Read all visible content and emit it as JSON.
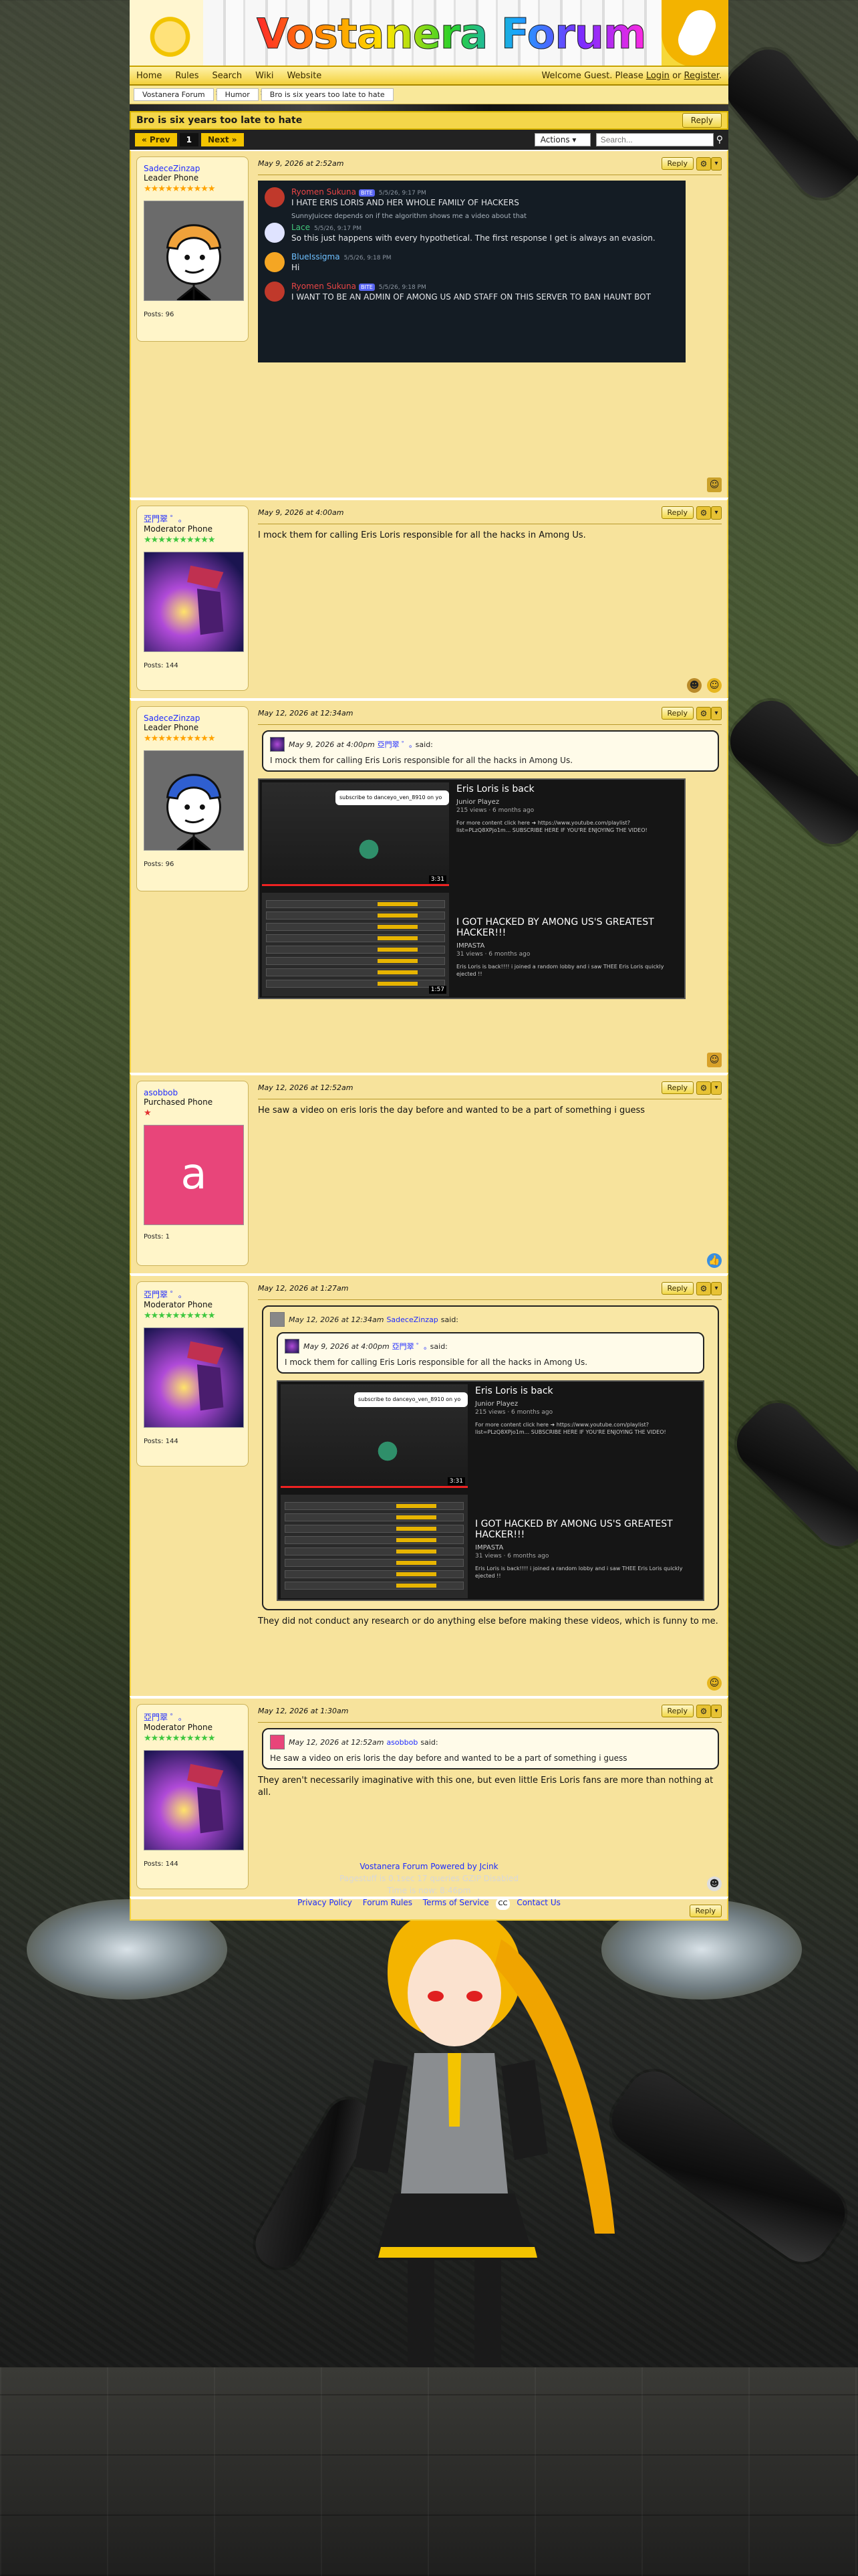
{
  "site": {
    "title": "Vostanera Forum",
    "nav": [
      "Home",
      "Rules",
      "Search",
      "Wiki",
      "Website"
    ],
    "welcome_prefix": "Welcome Guest. Please",
    "login": "Login",
    "or": "or",
    "register": "Register"
  },
  "breadcrumb": [
    "Vostanera Forum",
    "Humor",
    "Bro is six years too late to hate"
  ],
  "thread": {
    "title": "Bro is six years too late to hate",
    "reply_label": "Reply",
    "prev": "« Prev",
    "page": "1",
    "next": "Next »",
    "actions": "Actions",
    "search_placeholder": "Search..."
  },
  "posts": [
    {
      "user": "SadeceZinzap",
      "role": "Leader Phone",
      "stars": "★★★★★★★★★★",
      "posts": "Posts: 96",
      "date": "May 9, 2026 at 2:52am",
      "discord": [
        {
          "name": "Ryomen Sukuna",
          "badge": "BITE",
          "time": "5/5/26, 9:17 PM",
          "text": "I HATE ERIS LORIS AND HER WHOLE FAMILY OF HACKERS"
        },
        {
          "reply": "SunnyJuicee depends on if the algorithm shows me a video about that"
        },
        {
          "name": "Lace",
          "time": "5/5/26, 9:17 PM",
          "text": "So this just happens with every hypothetical. The first response I get is always an evasion."
        },
        {
          "name": "BlueIssigma",
          "time": "5/5/26, 9:18 PM",
          "text": "Hi"
        },
        {
          "name": "Ryomen Sukuna",
          "badge": "BITE",
          "time": "5/5/26, 9:18 PM",
          "text": "I WANT TO BE AN ADMIN OF AMONG US AND STAFF ON THIS SERVER TO BAN HAUNT BOT"
        }
      ]
    },
    {
      "user": "亞門翠 ゜｡",
      "role": "Moderator Phone",
      "stars": "★★★★★★★★★★",
      "posts": "Posts: 144",
      "date": "May 9, 2026 at 4:00am",
      "text": "I mock them for calling Eris Loris responsible for all the hacks in Among Us."
    },
    {
      "user": "SadeceZinzap",
      "role": "Leader Phone",
      "stars": "★★★★★★★★★★",
      "posts": "Posts: 96",
      "date": "May 12, 2026 at 12:34am",
      "quote": {
        "date": "May 9, 2026 at 4:00pm",
        "name": "亞門翠 ゜｡",
        "said": "said:",
        "text": "I mock them for calling Eris Loris responsible for all the hacks in Among Us."
      },
      "videos": [
        {
          "title": "Eris Loris is back",
          "channel": "Junior Playez",
          "meta": "215 views  ·  6 months ago",
          "desc": "For more content click here ➜ https://www.youtube.com/playlist?list=PLzQ8XPjo1m... SUBSCRIBE HERE IF YOU'RE ENJOYING THE VIDEO!",
          "duration": "3:31",
          "bubble": "subscribe to danceyo_ven_8910 on yo"
        },
        {
          "title": "I GOT HACKED BY AMONG US'S GREATEST HACKER!!!",
          "channel": "IMPASTA",
          "meta": "31 views  ·  6 months ago",
          "desc": "Eris Loris is back!!!! i joined a random lobby and i saw THEE Eris Loris quickly ejected !!",
          "duration": "1:57"
        }
      ]
    },
    {
      "user": "asobbob",
      "role": "Purchased Phone",
      "stars": "★",
      "posts": "Posts: 1",
      "avatar_letter": "a",
      "date": "May 12, 2026 at 12:52am",
      "text": "He saw a video on eris loris the day before and wanted to be a part of something i guess"
    },
    {
      "user": "亞門翠 ゜｡",
      "role": "Moderator Phone",
      "stars": "★★★★★★★★★★",
      "posts": "Posts: 144",
      "date": "May 12, 2026 at 1:27am",
      "outer_quote": {
        "date": "May 12, 2026 at 12:34am",
        "name": "SadeceZinzap",
        "said": "said:"
      },
      "quote": {
        "date": "May 9, 2026 at 4:00pm",
        "name": "亞門翠 ゜｡",
        "said": "said:",
        "text": "I mock them for calling Eris Loris responsible for all the hacks in Among Us."
      },
      "text": "They did not conduct any research or do anything else before making these videos, which is funny to me."
    },
    {
      "user": "亞門翠 ゜｡",
      "role": "Moderator Phone",
      "stars": "★★★★★★★★★★",
      "posts": "Posts: 144",
      "date": "May 12, 2026 at 1:30am",
      "quote": {
        "date": "May 12, 2026 at 12:52am",
        "name": "asobbob",
        "said": "said:",
        "text": "He saw a video on eris loris the day before and wanted to be a part of something i guess"
      },
      "text": "They aren't necessarily imaginative with this one, but even little Eris Loris fans are more than nothing at all."
    }
  ],
  "footer": {
    "line1": "Vostanera Forum Powered by Jcink",
    "line2": "Pagestuff is 0.1sec 17 queries  GZIP Disabled",
    "line3": "Time is now: 8:46pm",
    "links": [
      "Privacy Policy",
      "Forum Rules",
      "Terms of Service",
      "Contact Us"
    ],
    "cc": "CC"
  },
  "colors": {
    "header_yellow": "#f6d83a",
    "post_bg": "#f7e39c",
    "link_blue": "#1f2bff",
    "star_orange": "#ffa300"
  }
}
